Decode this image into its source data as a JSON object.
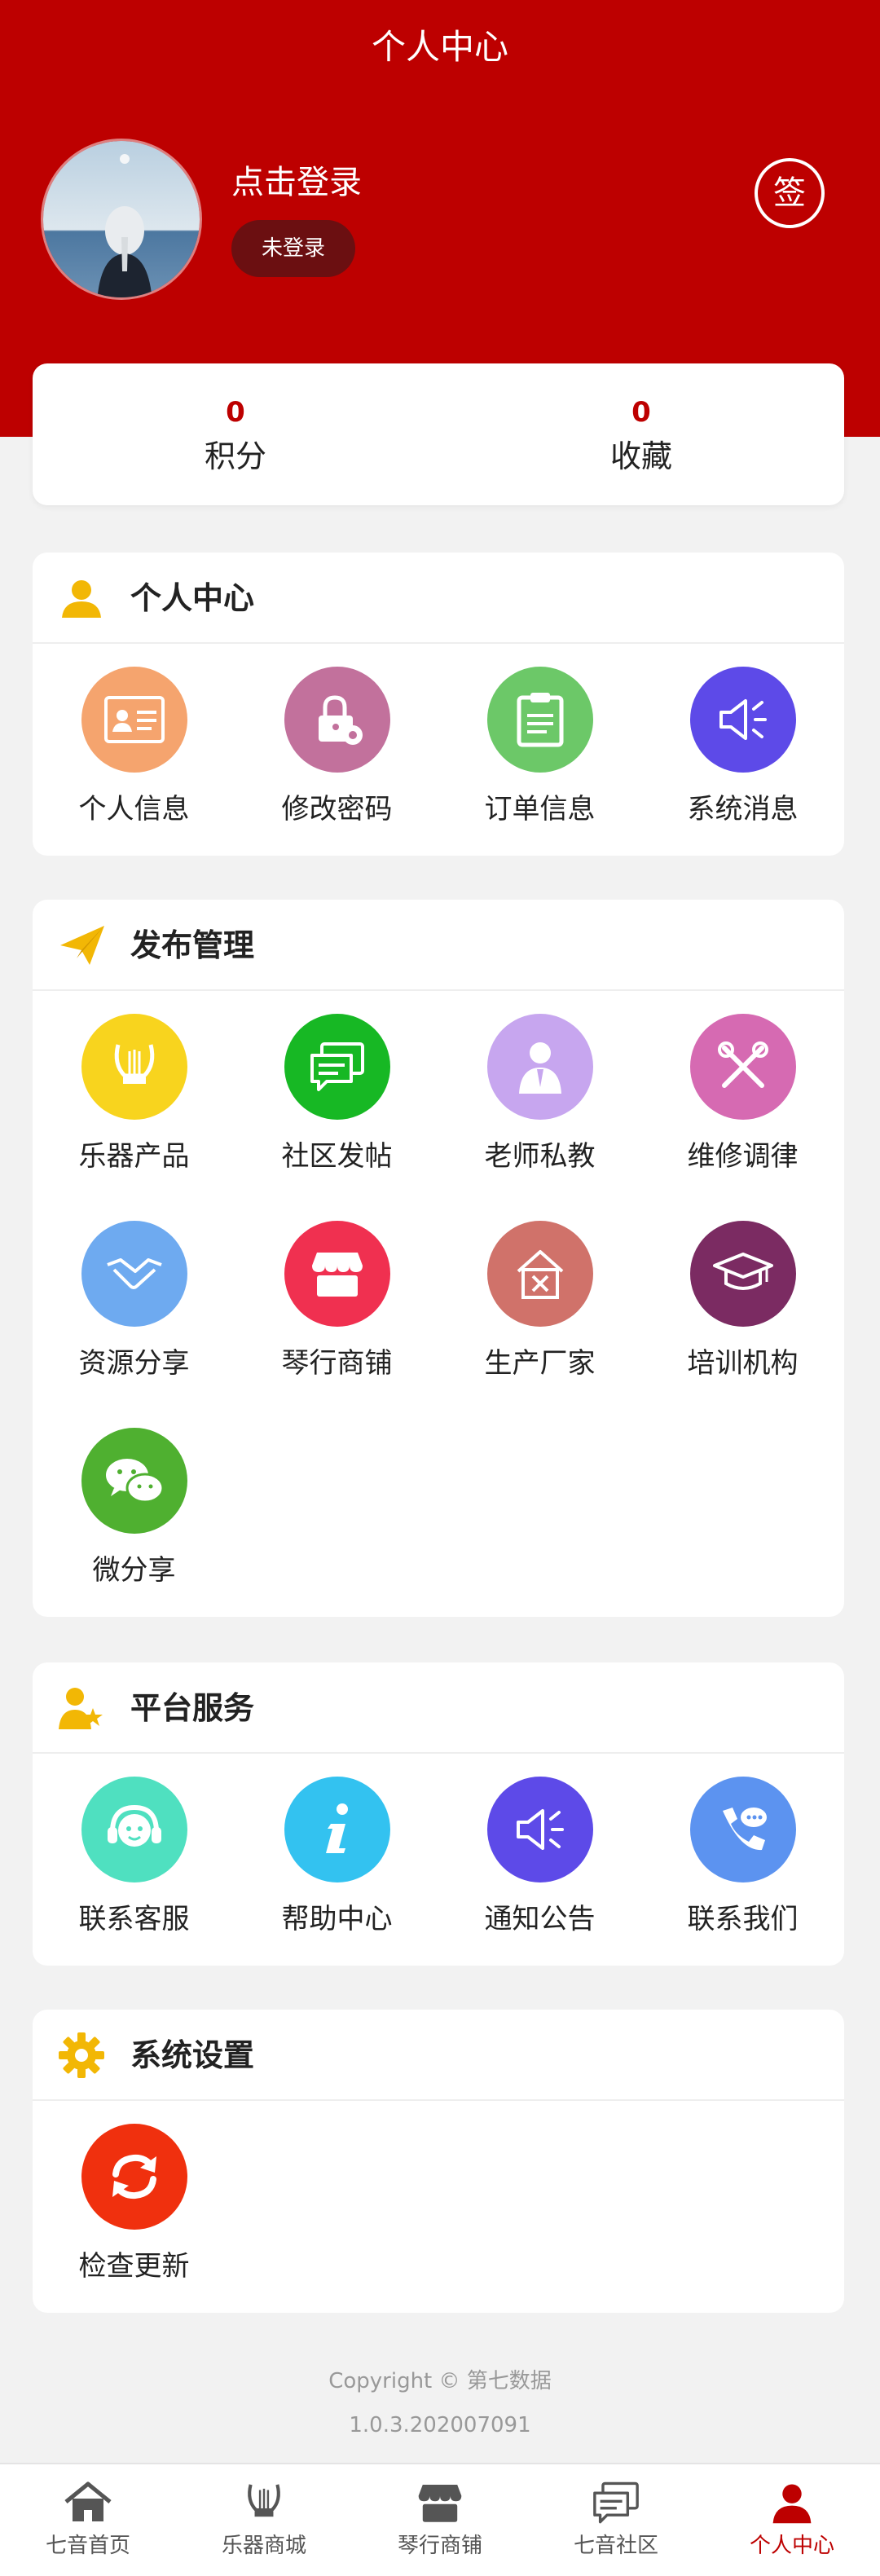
{
  "header": {
    "title": "个人中心"
  },
  "profile": {
    "login_prompt": "点击登录",
    "login_status": "未登录",
    "sign_label": "签"
  },
  "stats": [
    {
      "value": "0",
      "label": "积分"
    },
    {
      "value": "0",
      "label": "收藏"
    }
  ],
  "personal": {
    "title": "个人中心",
    "icon": "person-icon",
    "items": [
      {
        "label": "个人信息",
        "icon": "id-card-icon",
        "color": "#f5a46e"
      },
      {
        "label": "修改密码",
        "icon": "lock-settings-icon",
        "color": "#c2719c"
      },
      {
        "label": "订单信息",
        "icon": "clipboard-icon",
        "color": "#6cc868"
      },
      {
        "label": "系统消息",
        "icon": "megaphone-icon",
        "color": "#5d4ae8"
      }
    ]
  },
  "publish": {
    "title": "发布管理",
    "icon": "paper-plane-icon",
    "items": [
      {
        "label": "乐器产品",
        "icon": "lyre-icon",
        "color": "#f8d41e"
      },
      {
        "label": "社区发帖",
        "icon": "chat-icon",
        "color": "#17b824"
      },
      {
        "label": "老师私教",
        "icon": "teacher-icon",
        "color": "#c7a6ef"
      },
      {
        "label": "维修调律",
        "icon": "tools-icon",
        "color": "#d66ab2"
      },
      {
        "label": "资源分享",
        "icon": "handshake-icon",
        "color": "#6eaaf0"
      },
      {
        "label": "琴行商铺",
        "icon": "store-icon",
        "color": "#f03050"
      },
      {
        "label": "生产厂家",
        "icon": "factory-icon",
        "color": "#d0726a"
      },
      {
        "label": "培训机构",
        "icon": "graduation-cap-icon",
        "color": "#7b2b62"
      },
      {
        "label": "微分享",
        "icon": "wechat-icon",
        "color": "#4fb030"
      }
    ]
  },
  "platform": {
    "title": "平台服务",
    "icon": "user-group-icon",
    "items": [
      {
        "label": "联系客服",
        "icon": "headset-icon",
        "color": "#4fe0c0"
      },
      {
        "label": "帮助中心",
        "icon": "info-icon",
        "color": "#33c2f0"
      },
      {
        "label": "通知公告",
        "icon": "megaphone-icon",
        "color": "#5d4ae8"
      },
      {
        "label": "联系我们",
        "icon": "phone-chat-icon",
        "color": "#5c93f0"
      }
    ]
  },
  "settings": {
    "title": "系统设置",
    "icon": "gear-icon",
    "items": [
      {
        "label": "检查更新",
        "icon": "refresh-icon",
        "color": "#f0300e"
      }
    ]
  },
  "footer": {
    "copyright": "Copyright © 第七数据",
    "version": "1.0.3.202007091"
  },
  "tabbar": [
    {
      "label": "七音首页",
      "icon": "home-icon",
      "active": false
    },
    {
      "label": "乐器商城",
      "icon": "lyre-icon",
      "active": false
    },
    {
      "label": "琴行商铺",
      "icon": "store-icon",
      "active": false
    },
    {
      "label": "七音社区",
      "icon": "chat-icon",
      "active": false
    },
    {
      "label": "个人中心",
      "icon": "person-icon",
      "active": true
    }
  ],
  "colors": {
    "primary": "#bd0000",
    "badge": "#6b0f11",
    "section_icon": "#f2b705"
  }
}
